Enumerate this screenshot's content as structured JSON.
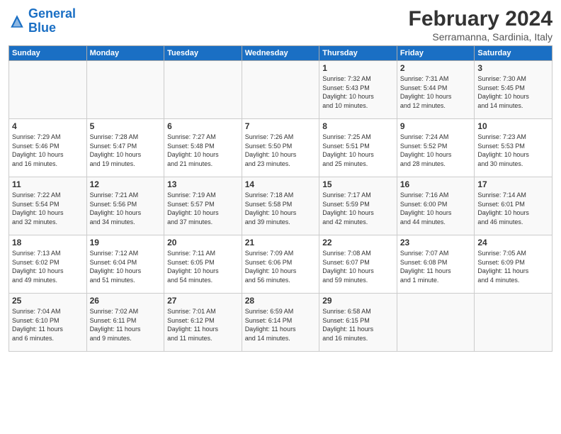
{
  "logo": {
    "line1": "General",
    "line2": "Blue"
  },
  "title": "February 2024",
  "location": "Serramanna, Sardinia, Italy",
  "days_header": [
    "Sunday",
    "Monday",
    "Tuesday",
    "Wednesday",
    "Thursday",
    "Friday",
    "Saturday"
  ],
  "weeks": [
    [
      {
        "day": "",
        "info": ""
      },
      {
        "day": "",
        "info": ""
      },
      {
        "day": "",
        "info": ""
      },
      {
        "day": "",
        "info": ""
      },
      {
        "day": "1",
        "info": "Sunrise: 7:32 AM\nSunset: 5:43 PM\nDaylight: 10 hours\nand 10 minutes."
      },
      {
        "day": "2",
        "info": "Sunrise: 7:31 AM\nSunset: 5:44 PM\nDaylight: 10 hours\nand 12 minutes."
      },
      {
        "day": "3",
        "info": "Sunrise: 7:30 AM\nSunset: 5:45 PM\nDaylight: 10 hours\nand 14 minutes."
      }
    ],
    [
      {
        "day": "4",
        "info": "Sunrise: 7:29 AM\nSunset: 5:46 PM\nDaylight: 10 hours\nand 16 minutes."
      },
      {
        "day": "5",
        "info": "Sunrise: 7:28 AM\nSunset: 5:47 PM\nDaylight: 10 hours\nand 19 minutes."
      },
      {
        "day": "6",
        "info": "Sunrise: 7:27 AM\nSunset: 5:48 PM\nDaylight: 10 hours\nand 21 minutes."
      },
      {
        "day": "7",
        "info": "Sunrise: 7:26 AM\nSunset: 5:50 PM\nDaylight: 10 hours\nand 23 minutes."
      },
      {
        "day": "8",
        "info": "Sunrise: 7:25 AM\nSunset: 5:51 PM\nDaylight: 10 hours\nand 25 minutes."
      },
      {
        "day": "9",
        "info": "Sunrise: 7:24 AM\nSunset: 5:52 PM\nDaylight: 10 hours\nand 28 minutes."
      },
      {
        "day": "10",
        "info": "Sunrise: 7:23 AM\nSunset: 5:53 PM\nDaylight: 10 hours\nand 30 minutes."
      }
    ],
    [
      {
        "day": "11",
        "info": "Sunrise: 7:22 AM\nSunset: 5:54 PM\nDaylight: 10 hours\nand 32 minutes."
      },
      {
        "day": "12",
        "info": "Sunrise: 7:21 AM\nSunset: 5:56 PM\nDaylight: 10 hours\nand 34 minutes."
      },
      {
        "day": "13",
        "info": "Sunrise: 7:19 AM\nSunset: 5:57 PM\nDaylight: 10 hours\nand 37 minutes."
      },
      {
        "day": "14",
        "info": "Sunrise: 7:18 AM\nSunset: 5:58 PM\nDaylight: 10 hours\nand 39 minutes."
      },
      {
        "day": "15",
        "info": "Sunrise: 7:17 AM\nSunset: 5:59 PM\nDaylight: 10 hours\nand 42 minutes."
      },
      {
        "day": "16",
        "info": "Sunrise: 7:16 AM\nSunset: 6:00 PM\nDaylight: 10 hours\nand 44 minutes."
      },
      {
        "day": "17",
        "info": "Sunrise: 7:14 AM\nSunset: 6:01 PM\nDaylight: 10 hours\nand 46 minutes."
      }
    ],
    [
      {
        "day": "18",
        "info": "Sunrise: 7:13 AM\nSunset: 6:02 PM\nDaylight: 10 hours\nand 49 minutes."
      },
      {
        "day": "19",
        "info": "Sunrise: 7:12 AM\nSunset: 6:04 PM\nDaylight: 10 hours\nand 51 minutes."
      },
      {
        "day": "20",
        "info": "Sunrise: 7:11 AM\nSunset: 6:05 PM\nDaylight: 10 hours\nand 54 minutes."
      },
      {
        "day": "21",
        "info": "Sunrise: 7:09 AM\nSunset: 6:06 PM\nDaylight: 10 hours\nand 56 minutes."
      },
      {
        "day": "22",
        "info": "Sunrise: 7:08 AM\nSunset: 6:07 PM\nDaylight: 10 hours\nand 59 minutes."
      },
      {
        "day": "23",
        "info": "Sunrise: 7:07 AM\nSunset: 6:08 PM\nDaylight: 11 hours\nand 1 minute."
      },
      {
        "day": "24",
        "info": "Sunrise: 7:05 AM\nSunset: 6:09 PM\nDaylight: 11 hours\nand 4 minutes."
      }
    ],
    [
      {
        "day": "25",
        "info": "Sunrise: 7:04 AM\nSunset: 6:10 PM\nDaylight: 11 hours\nand 6 minutes."
      },
      {
        "day": "26",
        "info": "Sunrise: 7:02 AM\nSunset: 6:11 PM\nDaylight: 11 hours\nand 9 minutes."
      },
      {
        "day": "27",
        "info": "Sunrise: 7:01 AM\nSunset: 6:12 PM\nDaylight: 11 hours\nand 11 minutes."
      },
      {
        "day": "28",
        "info": "Sunrise: 6:59 AM\nSunset: 6:14 PM\nDaylight: 11 hours\nand 14 minutes."
      },
      {
        "day": "29",
        "info": "Sunrise: 6:58 AM\nSunset: 6:15 PM\nDaylight: 11 hours\nand 16 minutes."
      },
      {
        "day": "",
        "info": ""
      },
      {
        "day": "",
        "info": ""
      }
    ]
  ]
}
